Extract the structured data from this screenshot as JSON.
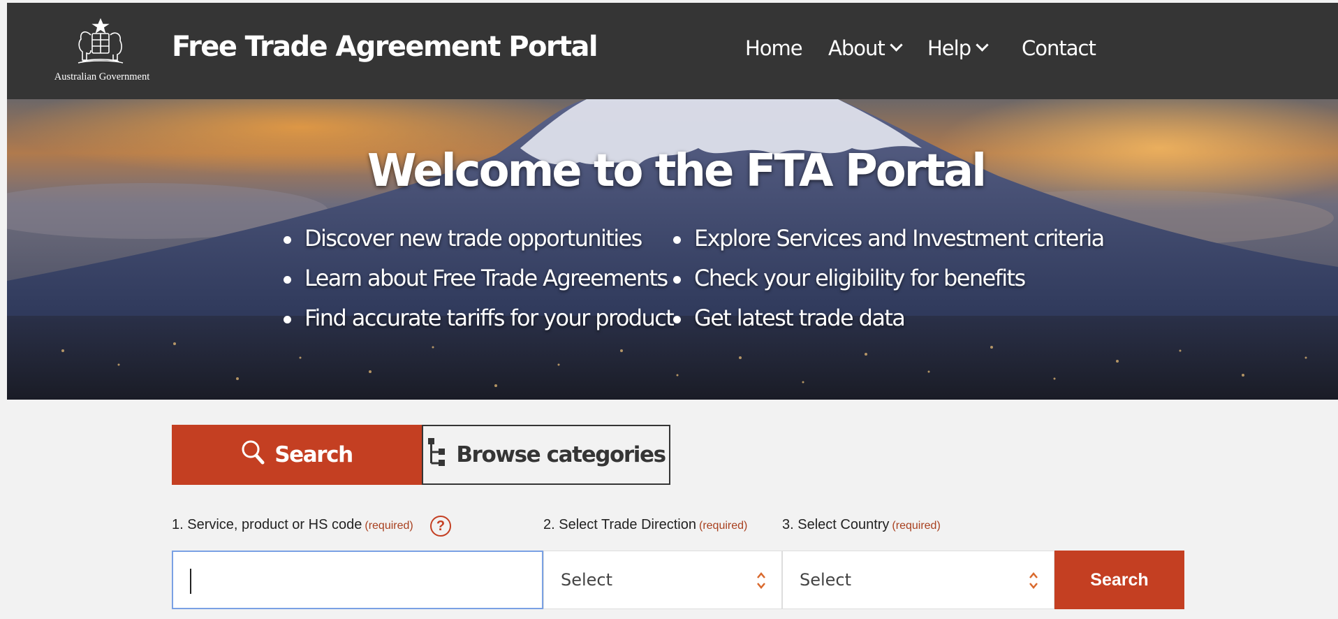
{
  "header": {
    "gov_name": "Australian Government",
    "site_title": "Free Trade Agreement Portal",
    "nav": [
      {
        "label": "Home",
        "has_dropdown": false
      },
      {
        "label": "About",
        "has_dropdown": true
      },
      {
        "label": "Help",
        "has_dropdown": true
      },
      {
        "label": "Contact",
        "has_dropdown": false
      }
    ]
  },
  "hero": {
    "title": "Welcome to the FTA Portal",
    "bullets_left": [
      "Discover new trade opportunities",
      "Learn about Free Trade Agreements",
      "Find accurate tariffs for your product"
    ],
    "bullets_right": [
      "Explore Services and Investment criteria",
      "Check your eligibility for benefits",
      "Get latest trade data"
    ]
  },
  "tabs": [
    {
      "label": "Search",
      "icon": "search-icon",
      "active": true
    },
    {
      "label": "Browse categories",
      "icon": "tree-icon",
      "active": false
    }
  ],
  "form": {
    "field1_label": "1. Service, product or HS code",
    "field2_label": "2. Select Trade Direction",
    "field3_label": "3. Select Country",
    "required_text": "(required)",
    "help_symbol": "?",
    "input_value": "",
    "select_direction": "Select",
    "select_country": "Select",
    "search_button": "Search"
  },
  "colors": {
    "header_bg": "#353535",
    "accent": "#c43f22",
    "page_bg": "#f2f2f2"
  }
}
